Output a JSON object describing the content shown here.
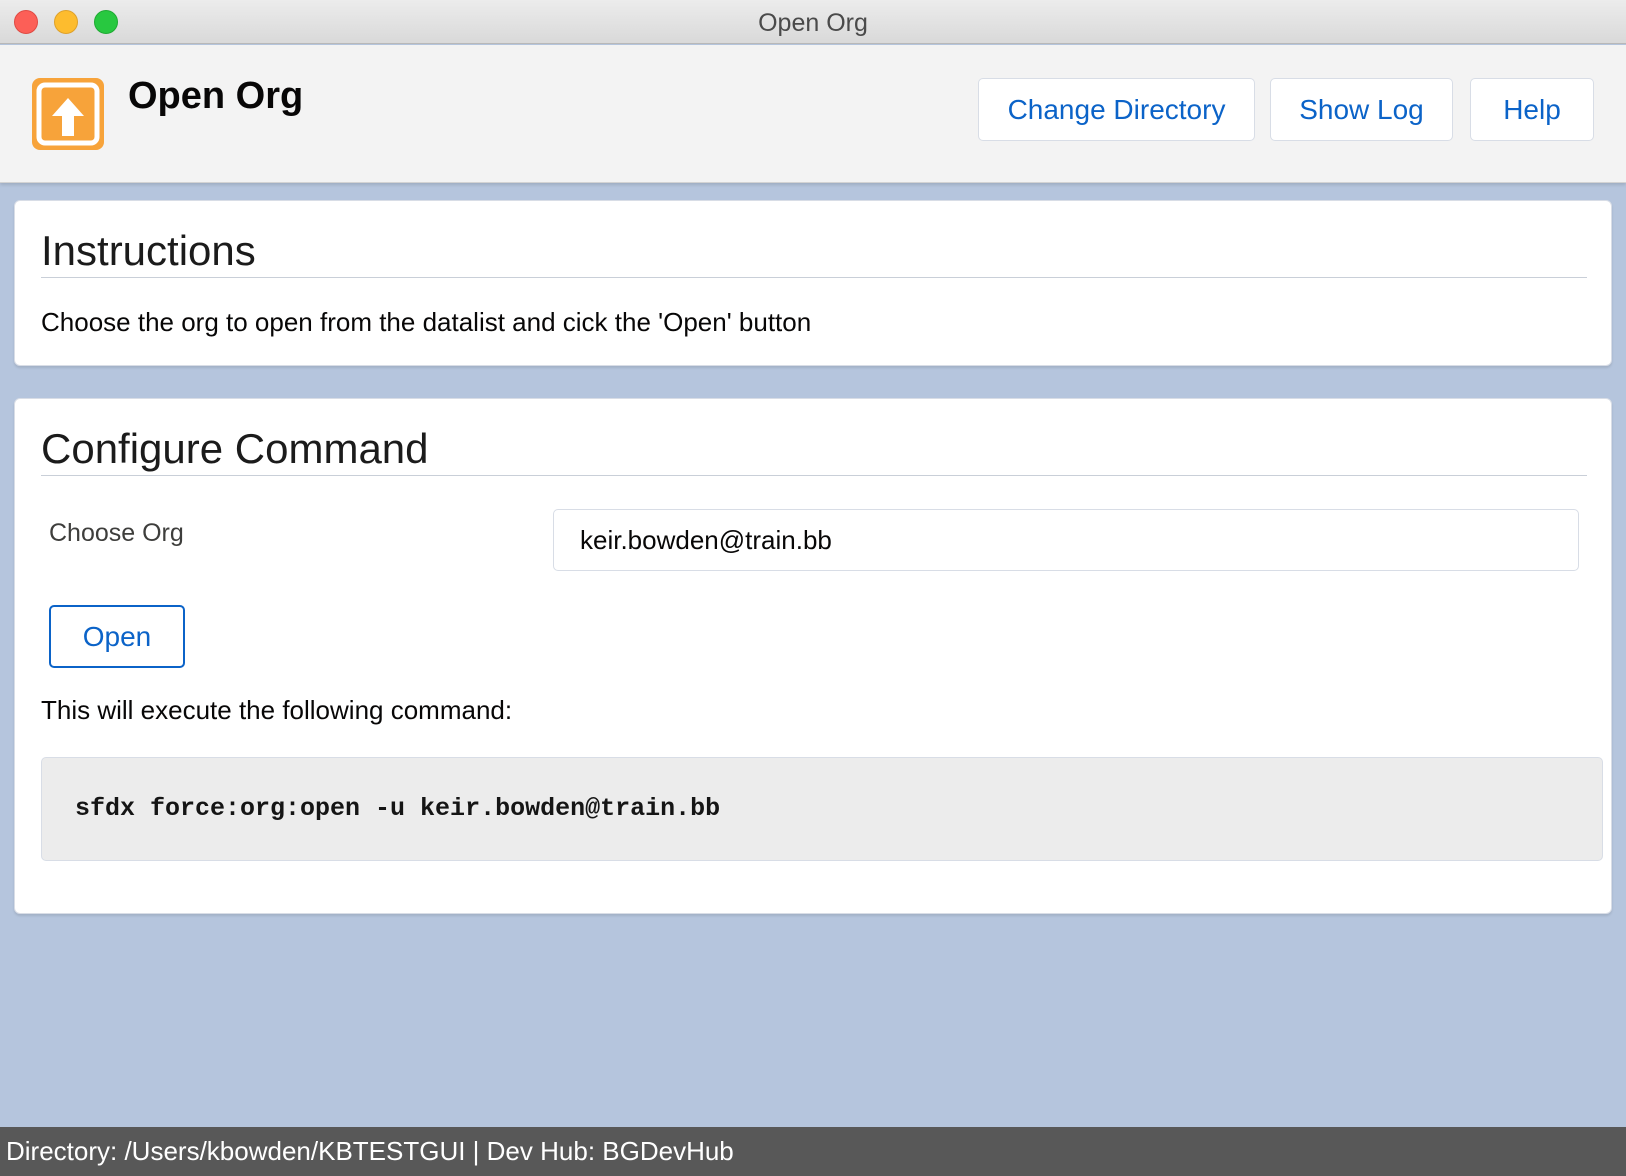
{
  "window": {
    "title": "Open Org"
  },
  "header": {
    "app_icon": "upload-arrow-icon",
    "title": "Open Org",
    "buttons": {
      "change_directory": "Change Directory",
      "show_log": "Show Log",
      "help": "Help"
    }
  },
  "instructions": {
    "heading": "Instructions",
    "text": "Choose the org to open from the datalist and cick the 'Open' button"
  },
  "configure": {
    "heading": "Configure Command",
    "choose_org_label": "Choose Org",
    "org_value": "keir.bowden@train.bb",
    "open_label": "Open",
    "execute_text": "This will execute the following command:",
    "command": "sfdx force:org:open -u keir.bowden@train.bb"
  },
  "status": {
    "text": "Directory: /Users/kbowden/KBTESTGUI | Dev Hub: BGDevHub"
  },
  "colors": {
    "background": "#b5c5dd",
    "accent": "#0b63c8",
    "app_icon": "#f7a33a",
    "status_bar": "#585858"
  }
}
